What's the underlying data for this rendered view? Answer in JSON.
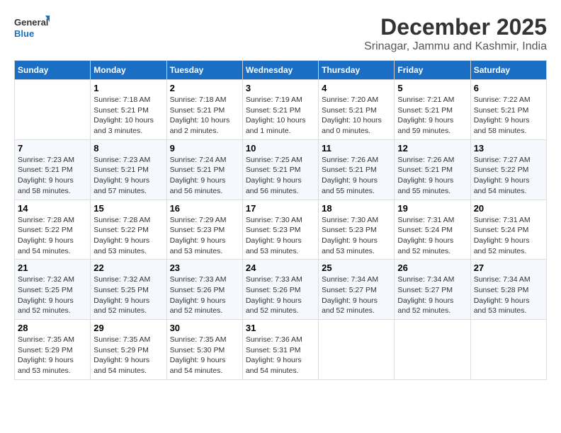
{
  "logo": {
    "line1": "General",
    "line2": "Blue"
  },
  "title": "December 2025",
  "subtitle": "Srinagar, Jammu and Kashmir, India",
  "days_of_week": [
    "Sunday",
    "Monday",
    "Tuesday",
    "Wednesday",
    "Thursday",
    "Friday",
    "Saturday"
  ],
  "weeks": [
    [
      {
        "day": "",
        "info": ""
      },
      {
        "day": "1",
        "info": "Sunrise: 7:18 AM\nSunset: 5:21 PM\nDaylight: 10 hours\nand 3 minutes."
      },
      {
        "day": "2",
        "info": "Sunrise: 7:18 AM\nSunset: 5:21 PM\nDaylight: 10 hours\nand 2 minutes."
      },
      {
        "day": "3",
        "info": "Sunrise: 7:19 AM\nSunset: 5:21 PM\nDaylight: 10 hours\nand 1 minute."
      },
      {
        "day": "4",
        "info": "Sunrise: 7:20 AM\nSunset: 5:21 PM\nDaylight: 10 hours\nand 0 minutes."
      },
      {
        "day": "5",
        "info": "Sunrise: 7:21 AM\nSunset: 5:21 PM\nDaylight: 9 hours\nand 59 minutes."
      },
      {
        "day": "6",
        "info": "Sunrise: 7:22 AM\nSunset: 5:21 PM\nDaylight: 9 hours\nand 58 minutes."
      }
    ],
    [
      {
        "day": "7",
        "info": "Sunrise: 7:23 AM\nSunset: 5:21 PM\nDaylight: 9 hours\nand 58 minutes."
      },
      {
        "day": "8",
        "info": "Sunrise: 7:23 AM\nSunset: 5:21 PM\nDaylight: 9 hours\nand 57 minutes."
      },
      {
        "day": "9",
        "info": "Sunrise: 7:24 AM\nSunset: 5:21 PM\nDaylight: 9 hours\nand 56 minutes."
      },
      {
        "day": "10",
        "info": "Sunrise: 7:25 AM\nSunset: 5:21 PM\nDaylight: 9 hours\nand 56 minutes."
      },
      {
        "day": "11",
        "info": "Sunrise: 7:26 AM\nSunset: 5:21 PM\nDaylight: 9 hours\nand 55 minutes."
      },
      {
        "day": "12",
        "info": "Sunrise: 7:26 AM\nSunset: 5:21 PM\nDaylight: 9 hours\nand 55 minutes."
      },
      {
        "day": "13",
        "info": "Sunrise: 7:27 AM\nSunset: 5:22 PM\nDaylight: 9 hours\nand 54 minutes."
      }
    ],
    [
      {
        "day": "14",
        "info": "Sunrise: 7:28 AM\nSunset: 5:22 PM\nDaylight: 9 hours\nand 54 minutes."
      },
      {
        "day": "15",
        "info": "Sunrise: 7:28 AM\nSunset: 5:22 PM\nDaylight: 9 hours\nand 53 minutes."
      },
      {
        "day": "16",
        "info": "Sunrise: 7:29 AM\nSunset: 5:23 PM\nDaylight: 9 hours\nand 53 minutes."
      },
      {
        "day": "17",
        "info": "Sunrise: 7:30 AM\nSunset: 5:23 PM\nDaylight: 9 hours\nand 53 minutes."
      },
      {
        "day": "18",
        "info": "Sunrise: 7:30 AM\nSunset: 5:23 PM\nDaylight: 9 hours\nand 53 minutes."
      },
      {
        "day": "19",
        "info": "Sunrise: 7:31 AM\nSunset: 5:24 PM\nDaylight: 9 hours\nand 52 minutes."
      },
      {
        "day": "20",
        "info": "Sunrise: 7:31 AM\nSunset: 5:24 PM\nDaylight: 9 hours\nand 52 minutes."
      }
    ],
    [
      {
        "day": "21",
        "info": "Sunrise: 7:32 AM\nSunset: 5:25 PM\nDaylight: 9 hours\nand 52 minutes."
      },
      {
        "day": "22",
        "info": "Sunrise: 7:32 AM\nSunset: 5:25 PM\nDaylight: 9 hours\nand 52 minutes."
      },
      {
        "day": "23",
        "info": "Sunrise: 7:33 AM\nSunset: 5:26 PM\nDaylight: 9 hours\nand 52 minutes."
      },
      {
        "day": "24",
        "info": "Sunrise: 7:33 AM\nSunset: 5:26 PM\nDaylight: 9 hours\nand 52 minutes."
      },
      {
        "day": "25",
        "info": "Sunrise: 7:34 AM\nSunset: 5:27 PM\nDaylight: 9 hours\nand 52 minutes."
      },
      {
        "day": "26",
        "info": "Sunrise: 7:34 AM\nSunset: 5:27 PM\nDaylight: 9 hours\nand 52 minutes."
      },
      {
        "day": "27",
        "info": "Sunrise: 7:34 AM\nSunset: 5:28 PM\nDaylight: 9 hours\nand 53 minutes."
      }
    ],
    [
      {
        "day": "28",
        "info": "Sunrise: 7:35 AM\nSunset: 5:29 PM\nDaylight: 9 hours\nand 53 minutes."
      },
      {
        "day": "29",
        "info": "Sunrise: 7:35 AM\nSunset: 5:29 PM\nDaylight: 9 hours\nand 54 minutes."
      },
      {
        "day": "30",
        "info": "Sunrise: 7:35 AM\nSunset: 5:30 PM\nDaylight: 9 hours\nand 54 minutes."
      },
      {
        "day": "31",
        "info": "Sunrise: 7:36 AM\nSunset: 5:31 PM\nDaylight: 9 hours\nand 54 minutes."
      },
      {
        "day": "",
        "info": ""
      },
      {
        "day": "",
        "info": ""
      },
      {
        "day": "",
        "info": ""
      }
    ]
  ]
}
